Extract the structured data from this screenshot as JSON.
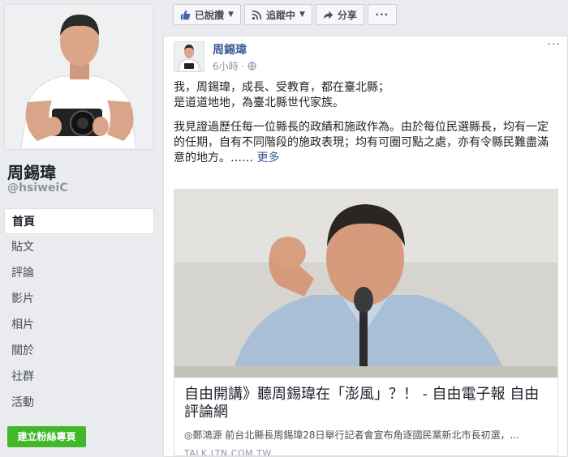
{
  "page": {
    "name": "周錫瑋",
    "handle": "@hsiweiC"
  },
  "nav": {
    "items": [
      {
        "label": "首頁",
        "active": true
      },
      {
        "label": "貼文"
      },
      {
        "label": "評論"
      },
      {
        "label": "影片"
      },
      {
        "label": "相片"
      },
      {
        "label": "關於"
      },
      {
        "label": "社群"
      },
      {
        "label": "活動"
      }
    ],
    "create_page": "建立粉絲專頁"
  },
  "actions": {
    "liked": "已說讚",
    "following": "追蹤中",
    "share": "分享",
    "more": "···"
  },
  "post": {
    "author": "周錫瑋",
    "time": "6小時",
    "privacy_icon": "globe-icon",
    "more": "···",
    "paragraph1": "我，周錫瑋，成長、受教育，都在臺北縣；\n是道道地地，為臺北縣世代家族。",
    "paragraph2": "我見證過歷任每一位縣長的政績和施政作為。由於每位民選縣長，均有一定的任期，自有不同階段的施政表現；均有可圈可點之處，亦有令縣民難盡滿意的地方。……",
    "see_more": "更多"
  },
  "link": {
    "title": "自由開講》聽周錫瑋在「澎風」？！ - 自由電子報 自由評論網",
    "description": "◎鄭鴻源 前台北縣長周錫瑋28日舉行記者會宣布角逐國民黨新北市長初選，...",
    "domain": "TALK.LTN.COM.TW"
  },
  "colors": {
    "link_blue": "#365899",
    "create_green": "#42b72a",
    "background": "#e9ebee"
  }
}
